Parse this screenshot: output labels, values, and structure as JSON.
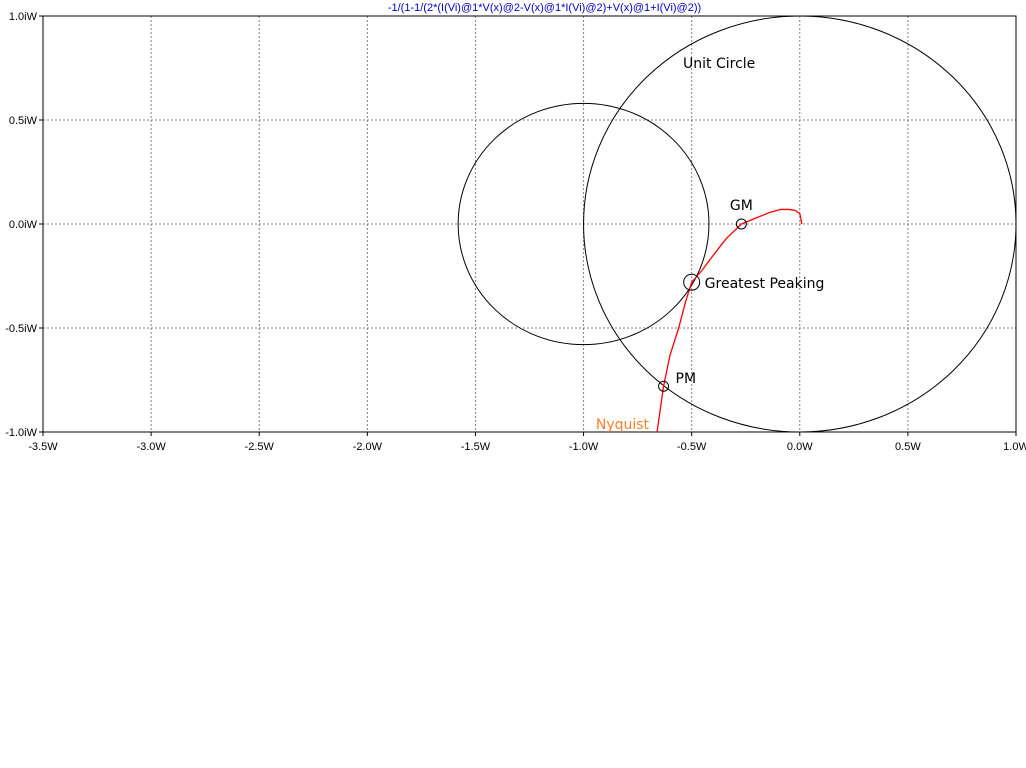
{
  "chart_data": {
    "type": "line",
    "title": "-1/(1-1/(2*(I(Vi)@1*V(x)@2-V(x)@1*I(Vi)@2)+V(x)@1+I(Vi)@2))",
    "title_color": "#0000c8",
    "xlabel": "",
    "ylabel": "",
    "xlim": [
      -3.5,
      1.0
    ],
    "ylim": [
      -1.0,
      1.0
    ],
    "grid": true,
    "x_ticks": [
      {
        "value": -3.5,
        "label": "-3.5W"
      },
      {
        "value": -3.0,
        "label": "-3.0W"
      },
      {
        "value": -2.5,
        "label": "-2.5W"
      },
      {
        "value": -2.0,
        "label": "-2.0W"
      },
      {
        "value": -1.5,
        "label": "-1.5W"
      },
      {
        "value": -1.0,
        "label": "-1.0W"
      },
      {
        "value": -0.5,
        "label": "-0.5W"
      },
      {
        "value": 0.0,
        "label": "0.0W"
      },
      {
        "value": 0.5,
        "label": "0.5W"
      },
      {
        "value": 1.0,
        "label": "1.0W"
      }
    ],
    "y_ticks": [
      {
        "value": 1.0,
        "label": "1.0iW"
      },
      {
        "value": 0.5,
        "label": "0.5iW"
      },
      {
        "value": 0.0,
        "label": "0.0iW"
      },
      {
        "value": -0.5,
        "label": "-0.5iW"
      },
      {
        "value": -1.0,
        "label": "-1.0iW"
      }
    ],
    "series": [
      {
        "name": "Nyquist",
        "color": "#ff0000",
        "label_color": "#ff7f27",
        "x": [
          0.01,
          0.0,
          -0.02,
          -0.05,
          -0.09,
          -0.14,
          -0.2,
          -0.27,
          -0.34,
          -0.4,
          -0.45,
          -0.5,
          -0.53,
          -0.56,
          -0.6,
          -0.63,
          -0.66
        ],
        "y": [
          0.0,
          0.05,
          0.065,
          0.07,
          0.07,
          0.055,
          0.03,
          0.0,
          -0.07,
          -0.15,
          -0.22,
          -0.28,
          -0.38,
          -0.5,
          -0.63,
          -0.78,
          -1.0
        ]
      }
    ],
    "reference_circles": [
      {
        "name": "Unit Circle",
        "center": [
          0.0,
          0.0
        ],
        "radius": 1.0,
        "color": "#000000"
      },
      {
        "center": [
          -1.0,
          0.0
        ],
        "radius": 0.58,
        "color": "#000000"
      }
    ],
    "markers": [
      {
        "label": "GM",
        "x": -0.27,
        "y": 0.0,
        "r": 5
      },
      {
        "label": "Greatest Peaking",
        "x": -0.5,
        "y": -0.28,
        "r": 8
      },
      {
        "label": "PM",
        "x": -0.63,
        "y": -0.78,
        "r": 5
      }
    ],
    "annotations": [
      {
        "text": "Unit Circle",
        "x": -0.54,
        "y": 0.75
      }
    ]
  }
}
